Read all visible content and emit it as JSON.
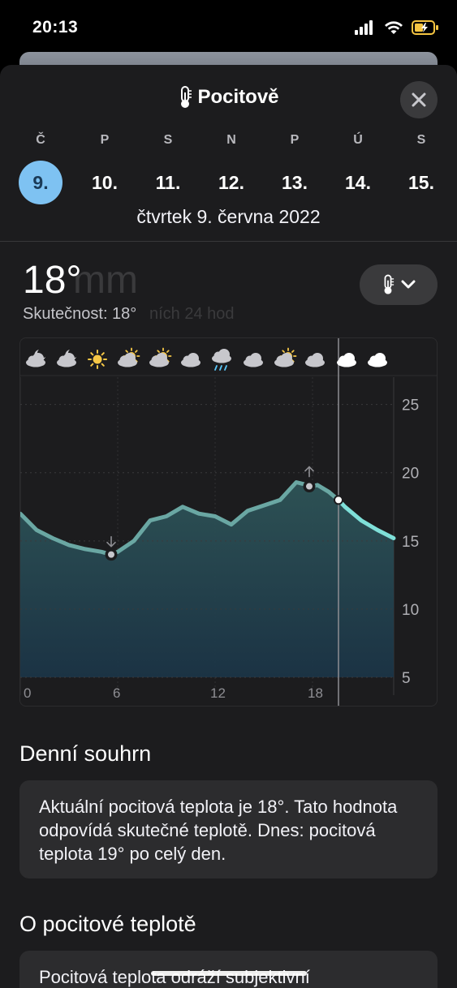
{
  "status": {
    "time": "20:13",
    "battery_color": "#f5c542"
  },
  "header": {
    "title": "Pocitově",
    "title_icon": "thermometer-icon",
    "close_icon": "close-icon"
  },
  "days": [
    {
      "letter": "Č",
      "number": "9.",
      "selected": true
    },
    {
      "letter": "P",
      "number": "10.",
      "selected": false
    },
    {
      "letter": "S",
      "number": "11.",
      "selected": false
    },
    {
      "letter": "N",
      "number": "12.",
      "selected": false
    },
    {
      "letter": "P",
      "number": "13.",
      "selected": false
    },
    {
      "letter": "Ú",
      "number": "14.",
      "selected": false
    },
    {
      "letter": "S",
      "number": "15.",
      "selected": false
    }
  ],
  "date_label": "čtvrtek 9. června 2022",
  "current": {
    "temp": "18°",
    "ghost": "mm",
    "actual": "Skutečnost: 18°",
    "ghost_actual": "ních 24 hod"
  },
  "selector": {
    "icon": "thermometer-icon",
    "chevron": "chevron-down-icon"
  },
  "chart_data": {
    "type": "area",
    "x_ticks": [
      "0",
      "6",
      "12",
      "18"
    ],
    "y_ticks": [
      "25",
      "20",
      "15",
      "10",
      "5"
    ],
    "ylim": [
      5,
      27
    ],
    "xlim": [
      0,
      23
    ],
    "now_hour": 19.6,
    "hours": [
      0,
      1,
      2,
      3,
      4,
      5,
      5.6,
      6,
      7,
      8,
      9,
      10,
      11,
      12,
      13,
      14,
      15,
      16,
      17,
      18,
      18.3,
      19,
      19.6,
      20,
      21,
      22,
      23
    ],
    "values": [
      17.0,
      15.8,
      15.2,
      14.7,
      14.4,
      14.2,
      14.0,
      14.2,
      15.0,
      16.5,
      16.8,
      17.5,
      17.0,
      16.8,
      16.2,
      17.2,
      17.6,
      18.0,
      19.3,
      19.0,
      19.1,
      18.6,
      18.0,
      17.5,
      16.5,
      15.8,
      15.2
    ],
    "min": {
      "hour": 5.6,
      "value": 14
    },
    "max": {
      "hour": 17.8,
      "value": 19
    },
    "weather_icons": [
      "partly-cloudy-night-icon",
      "partly-cloudy-night-icon",
      "sun-icon",
      "partly-sunny-icon",
      "partly-sunny-icon",
      "cloud-icon",
      "rain-cloud-icon",
      "cloud-icon",
      "partly-sunny-icon",
      "cloud-icon",
      "cloud-icon",
      "cloud-icon"
    ],
    "colors": {
      "line_past": "#6aa7a3",
      "line_future": "#7fe0d9",
      "fill": "#1f3b45"
    }
  },
  "summary": {
    "title": "Denní souhrn",
    "text": "Aktuální pocitová teplota je 18°. Tato hodnota odpovídá skutečné teplotě. Dnes: pocitová teplota 19° po celý den."
  },
  "about": {
    "title": "O pocitové teplotě",
    "text": "Pocitová teplota odráží subjektivní"
  }
}
